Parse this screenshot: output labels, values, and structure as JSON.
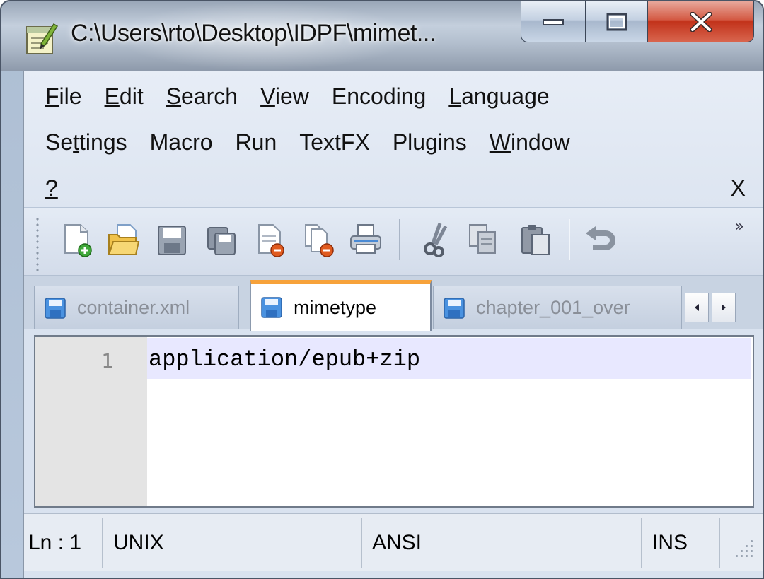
{
  "window": {
    "title": "C:\\Users\\rto\\Desktop\\IDPF\\mimet...",
    "app_icon": "notepad-icon",
    "controls": [
      "minimize-icon",
      "maximize-icon",
      "close-icon"
    ]
  },
  "menu": {
    "items": [
      {
        "mnemonic": "F",
        "rest": "ile"
      },
      {
        "mnemonic": "E",
        "rest": "dit"
      },
      {
        "mnemonic": "S",
        "rest": "earch"
      },
      {
        "mnemonic": "V",
        "rest": "iew"
      },
      {
        "pre": "Encoding"
      },
      {
        "mnemonic": "L",
        "rest": "anguage"
      },
      {
        "pre": "Se",
        "mnemonic": "t",
        "rest": "tings"
      },
      {
        "pre": "Macro"
      },
      {
        "pre": "Run"
      },
      {
        "pre": "TextFX"
      },
      {
        "pre": "Plugins"
      },
      {
        "mnemonic": "W",
        "rest": "indow"
      },
      {
        "mnemonic": "?",
        "rest": ""
      }
    ],
    "close_doc": "X"
  },
  "toolbar": {
    "icons": [
      "new-file-icon",
      "open-folder-icon",
      "save-icon",
      "save-all-icon",
      "close-icon",
      "close-all-icon",
      "print-icon",
      "cut-icon",
      "copy-icon",
      "paste-icon",
      "undo-icon"
    ],
    "overflow": "»"
  },
  "tabs": [
    {
      "label": "container.xml",
      "active": false
    },
    {
      "label": "mimetype",
      "active": true
    },
    {
      "label": "chapter_001_over",
      "active": false
    }
  ],
  "editor": {
    "lines": [
      {
        "number": "1",
        "text": "application/epub+zip"
      }
    ]
  },
  "status": {
    "position": "Ln : 1",
    "eol": "UNIX",
    "encoding": "ANSI",
    "mode": "INS"
  },
  "colors": {
    "active_tab_accent": "#f7a23a",
    "current_line": "#e8e8ff",
    "close_button": "#c2321a"
  }
}
